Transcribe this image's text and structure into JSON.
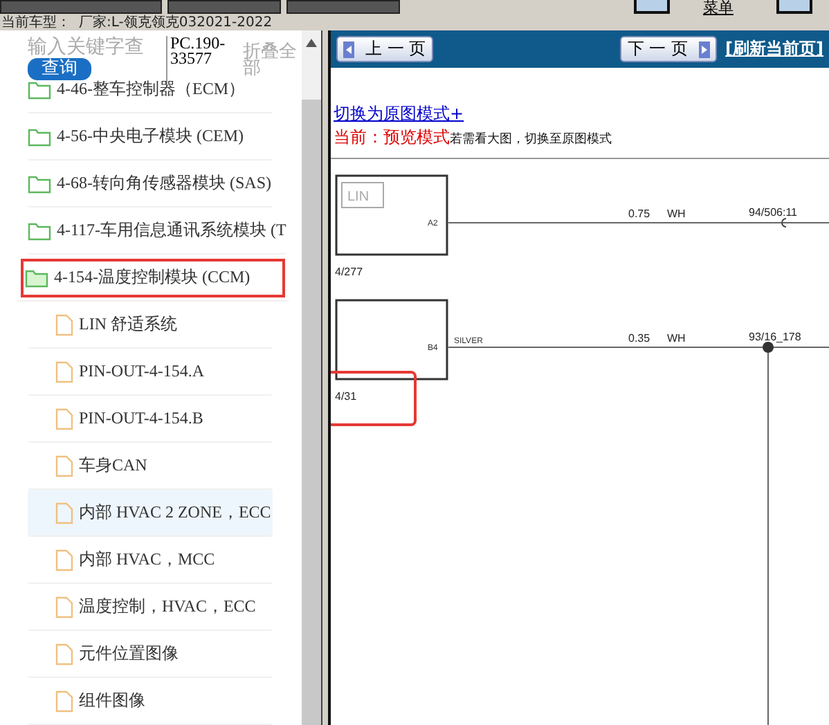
{
  "toolbar": {
    "menu_link": "菜单"
  },
  "vehicle": {
    "label": "当前车型：",
    "value": "厂家:L-领克领克032021-2022"
  },
  "search": {
    "placeholder": "输入关键字查",
    "button": "查询",
    "code": "PC.190-33577",
    "collapse": "折叠全部"
  },
  "tree": [
    {
      "kind": "folder",
      "label": "4-46-整车控制器（ECM）",
      "marked": false,
      "open": false,
      "hover": false
    },
    {
      "kind": "folder",
      "label": "4-56-中央电子模块 (CEM)",
      "marked": false,
      "open": false,
      "hover": false
    },
    {
      "kind": "folder",
      "label": "4-68-转向角传感器模块 (SAS)",
      "marked": false,
      "open": false,
      "hover": false
    },
    {
      "kind": "folder",
      "label": "4-117-车用信息通讯系统模块 (T",
      "marked": false,
      "open": false,
      "hover": false
    },
    {
      "kind": "folder",
      "label": "4-154-温度控制模块 (CCM)",
      "marked": true,
      "open": true,
      "hover": false
    },
    {
      "kind": "file",
      "label": "LIN 舒适系统",
      "marked": false,
      "hover": false
    },
    {
      "kind": "file",
      "label": "PIN-OUT-4-154.A",
      "marked": false,
      "hover": false
    },
    {
      "kind": "file",
      "label": "PIN-OUT-4-154.B",
      "marked": false,
      "hover": false
    },
    {
      "kind": "file",
      "label": "车身CAN",
      "marked": false,
      "hover": false
    },
    {
      "kind": "file",
      "label": "内部 HVAC 2 ZONE，ECC",
      "marked": false,
      "hover": true
    },
    {
      "kind": "file",
      "label": "内部 HVAC，MCC",
      "marked": false,
      "hover": false
    },
    {
      "kind": "file",
      "label": "温度控制，HVAC，ECC",
      "marked": false,
      "hover": false
    },
    {
      "kind": "file",
      "label": "元件位置图像",
      "marked": false,
      "hover": false
    },
    {
      "kind": "file",
      "label": "组件图像",
      "marked": false,
      "hover": false
    }
  ],
  "nav": {
    "prev": "上 一 页",
    "next": "下 一 页",
    "refresh": "[刷新当前页]"
  },
  "mode": {
    "switch_link": "切换为原图模式+",
    "current": "当前：预览模式",
    "hint": "若需看大图，切换至原图模式"
  },
  "diagram": {
    "components": [
      {
        "logo": "LIN",
        "pin": "A2",
        "ref": "4/277",
        "gauge": "0.75",
        "wire_code": "WH",
        "target": "94/506:11",
        "kind": "connector",
        "marked": false
      },
      {
        "pin": "B4",
        "ref": "4/31",
        "wire_note": "SILVER",
        "gauge": "0.35",
        "wire_code": "WH",
        "target": "93/16_178",
        "kind": "splice",
        "marked": true
      }
    ]
  }
}
